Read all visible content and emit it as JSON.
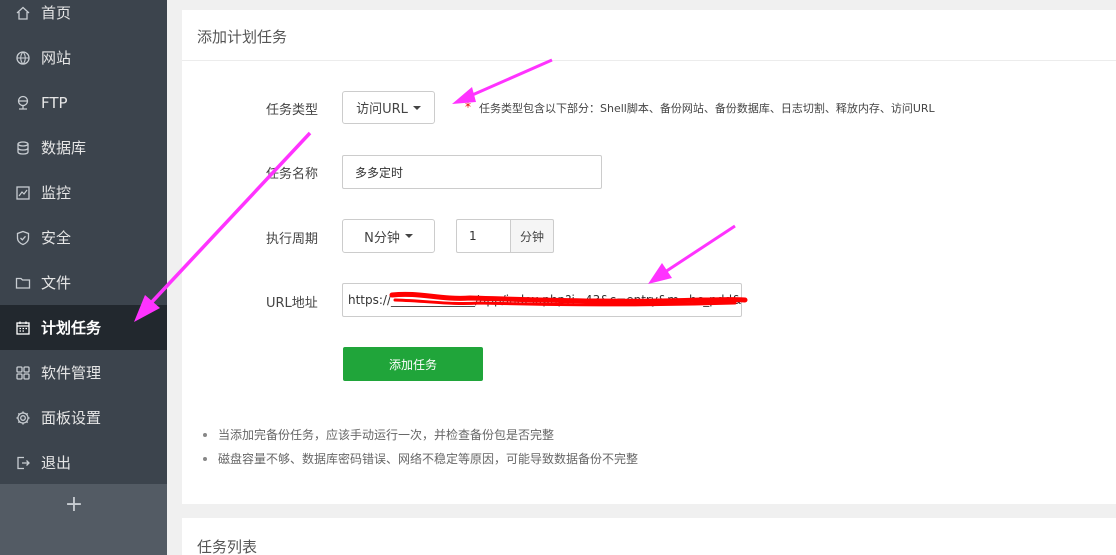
{
  "sidebar": {
    "items": [
      {
        "label": "首页",
        "icon": "home-icon"
      },
      {
        "label": "网站",
        "icon": "globe-icon"
      },
      {
        "label": "FTP",
        "icon": "ftp-icon"
      },
      {
        "label": "数据库",
        "icon": "database-icon"
      },
      {
        "label": "监控",
        "icon": "monitor-icon"
      },
      {
        "label": "安全",
        "icon": "shield-icon"
      },
      {
        "label": "文件",
        "icon": "folder-icon"
      },
      {
        "label": "计划任务",
        "icon": "calendar-icon",
        "active": true
      },
      {
        "label": "软件管理",
        "icon": "apps-grid-icon"
      },
      {
        "label": "面板设置",
        "icon": "gear-icon"
      },
      {
        "label": "退出",
        "icon": "logout-icon"
      }
    ],
    "add_label": "+"
  },
  "form": {
    "panel_title": "添加计划任务",
    "task_type_label": "任务类型",
    "task_type_value": "访问URL",
    "task_type_star": "*",
    "task_type_hint": "任务类型包含以下部分：Shell脚本、备份网站、备份数据库、日志切割、释放内存、访问URL",
    "task_name_label": "任务名称",
    "task_name_value": "多多定时",
    "period_label": "执行周期",
    "period_value": "N分钟",
    "period_amount": "1",
    "period_unit": "分钟",
    "url_label": "URL地址",
    "url_value": "https://______________/app/index.php?i=43&c=entry&m=hc_pdd&do=",
    "submit_label": "添加任务"
  },
  "notes": [
    "当添加完备份任务，应该手动运行一次，并检查备份包是否完整",
    "磁盘容量不够、数据库密码错误、网络不稳定等原因，可能导致数据备份不完整"
  ],
  "task_list": {
    "panel_title": "任务列表"
  },
  "colors": {
    "sidebar_bg": "#3c444d",
    "sidebar_active": "#22282e",
    "accent_green": "#20a53a",
    "annotation_arrow": "#ff33ff",
    "redaction": "#ff0000"
  }
}
